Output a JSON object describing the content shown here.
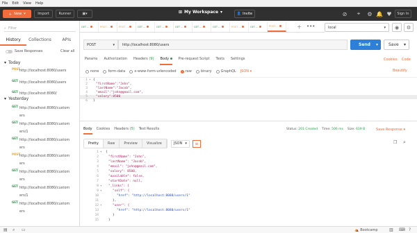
{
  "menu": [
    "File",
    "Edit",
    "View",
    "Help"
  ],
  "header": {
    "new_label": "New",
    "import_label": "Import",
    "runner_label": "Runner",
    "workspace_label": "My Workspace",
    "invite_label": "Invite",
    "signin_label": "Sign In"
  },
  "sidebar": {
    "filter_placeholder": "Filter",
    "tabs": [
      "History",
      "Collections",
      "APIs"
    ],
    "save_responses": "Save Responses",
    "clear_all": "Clear all",
    "today": "Today",
    "yesterday": "Yesterday",
    "today_items": [
      {
        "method": "POST",
        "url": "http://localhost:8080/users"
      },
      {
        "method": "GET",
        "url": "http://localhost:8080/users"
      },
      {
        "method": "GET",
        "url": "http://localhost:8080/"
      }
    ],
    "yesterday_items": [
      {
        "method": "GET",
        "l1": "http://localhost:8080/custom",
        "l2": "ers"
      },
      {
        "method": "GET",
        "l1": "http://localhost:8080/custom",
        "l2": "ers/1"
      },
      {
        "method": "GET",
        "l1": "http://localhost:8080/custom",
        "l2": "ers"
      },
      {
        "method": "POST",
        "l1": "http://localhost:8080/custom",
        "l2": "ers"
      },
      {
        "method": "GET",
        "l1": "http://localhost:8080/custom",
        "l2": "ers"
      },
      {
        "method": "GET",
        "l1": "http://localhost:8080/custom",
        "l2": "ers/1"
      },
      {
        "method": "GET",
        "l1": "http://localhost:8080/custom",
        "l2": "ers"
      }
    ]
  },
  "request_tabs": [
    {
      "method": "GET",
      "label": "GET ..."
    },
    {
      "method": "POST",
      "label": "POST ..."
    },
    {
      "method": "POST",
      "label": "POST ..."
    },
    {
      "method": "GET",
      "label": "GET ..."
    },
    {
      "method": "GET",
      "label": "GET ..."
    },
    {
      "method": "GET",
      "label": "GET ..."
    },
    {
      "method": "GET",
      "label": "GET ..."
    },
    {
      "method": "GET",
      "label": "GET ..."
    },
    {
      "method": "POST",
      "label": "POST ..."
    },
    {
      "method": "GET",
      "label": "GET ..."
    },
    {
      "method": "POST",
      "label": "POST ..."
    }
  ],
  "environment": "local",
  "request": {
    "method": "POST",
    "url": "http://localhost:8080/users",
    "send_label": "Send",
    "save_label": "Save"
  },
  "req_tabs": {
    "params": "Params",
    "authorization": "Authorization",
    "headers": "Headers",
    "headers_count": "(9)",
    "body": "Body",
    "pre_request": "Pre-request Script",
    "tests": "Tests",
    "settings": "Settings",
    "cookies": "Cookies",
    "code": "Code"
  },
  "body_options": {
    "none": "none",
    "form_data": "form-data",
    "urlencoded": "x-www-form-urlencoded",
    "raw": "raw",
    "binary": "binary",
    "graphql": "GraphQL",
    "json": "JSON",
    "beautify": "Beautify"
  },
  "request_body_lines": [
    "{",
    "\"firstName\":\"John\",",
    "\"lastName\":\"Jacob\",",
    "\"email\":\"john@gmail.com\",",
    "\"salary\":8500",
    "}"
  ],
  "response_tabs": {
    "body": "Body",
    "cookies": "Cookies",
    "headers": "Headers",
    "headers_count": "(5)",
    "test_results": "Test Results"
  },
  "response_status": {
    "status_label": "Status:",
    "status": "201 Created",
    "time_label": "Time:",
    "time": "506 ms",
    "size_label": "Size:",
    "size": "619 B",
    "save_response": "Save Response"
  },
  "view_modes": [
    "Pretty",
    "Raw",
    "Preview",
    "Visualize"
  ],
  "view_format": "JSON",
  "response_lines": [
    "{",
    "\"firstName\": \"John\",",
    "\"lastName\": \"Jacob\",",
    "\"email\": \"john@gmail.com\",",
    "\"salary\": 8500,",
    "\"available\": false,",
    "\"startDate\": null,",
    "\"_links\": {",
    "\"self\": {",
    "\"href\": \"http://localhost:8080/users/1\"",
    "},",
    "\"user\": {",
    "\"href\": \"http://localhost:8080/users/1\"",
    "}",
    "}"
  ],
  "footer": {
    "bootcamp": "Bootcamp"
  }
}
